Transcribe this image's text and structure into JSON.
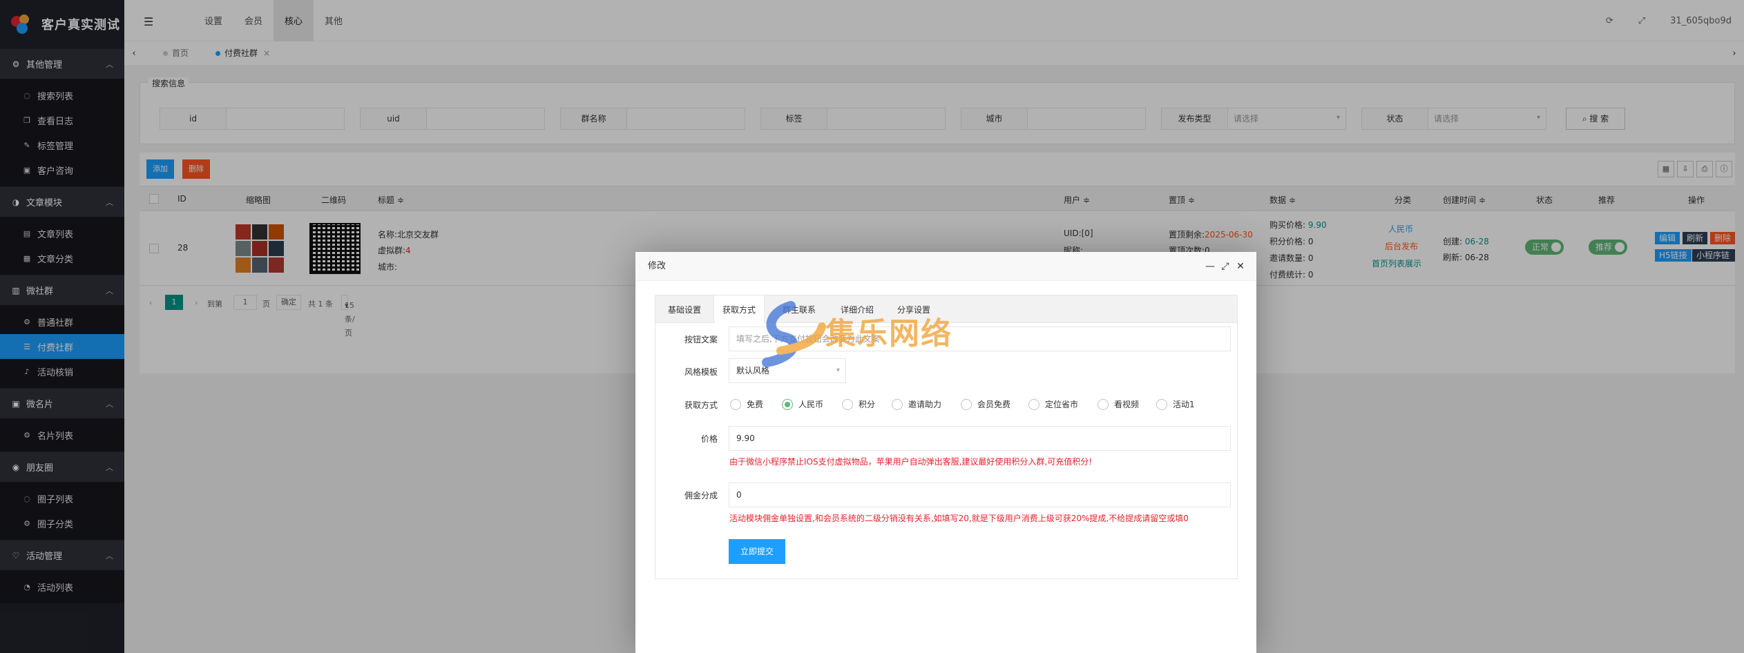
{
  "app": {
    "title": "客户真实测试"
  },
  "sidebar": {
    "groups": [
      {
        "label": "其他管理",
        "icon": "gear-icon",
        "items": [
          {
            "label": "搜索列表",
            "icon": "chat-icon"
          },
          {
            "label": "查看日志",
            "icon": "copy-icon"
          },
          {
            "label": "标签管理",
            "icon": "edit-icon"
          },
          {
            "label": "客户咨询",
            "icon": "user-icon"
          }
        ]
      },
      {
        "label": "文章模块",
        "icon": "contrast-icon",
        "items": [
          {
            "label": "文章列表",
            "icon": "doc-icon"
          },
          {
            "label": "文章分类",
            "icon": "table-icon"
          }
        ]
      },
      {
        "label": "微社群",
        "icon": "group-icon",
        "items": [
          {
            "label": "普通社群",
            "icon": "gear-icon"
          },
          {
            "label": "付费社群",
            "icon": "list-icon",
            "active": true
          },
          {
            "label": "活动核销",
            "icon": "bell-icon"
          }
        ]
      },
      {
        "label": "微名片",
        "icon": "card-icon",
        "items": [
          {
            "label": "名片列表",
            "icon": "gear-icon"
          }
        ]
      },
      {
        "label": "朋友圈",
        "icon": "circle-icon",
        "items": [
          {
            "label": "圈子列表",
            "icon": "chat-icon"
          },
          {
            "label": "圈子分类",
            "icon": "gear-icon"
          }
        ]
      },
      {
        "label": "活动管理",
        "icon": "heart-icon",
        "items": [
          {
            "label": "活动列表",
            "icon": "dashboard-icon"
          }
        ]
      }
    ]
  },
  "header": {
    "menu": [
      "设置",
      "会员",
      "核心",
      "其他"
    ],
    "active_menu": "核心",
    "user": "31_605qbo9d"
  },
  "page_tabs": [
    {
      "label": "首页"
    },
    {
      "label": "付费社群",
      "active": true
    }
  ],
  "search": {
    "legend": "搜索信息",
    "fields": [
      "id",
      "uid",
      "群名称",
      "标签",
      "城市"
    ],
    "selects": [
      {
        "label": "发布类型",
        "value": "请选择"
      },
      {
        "label": "状态",
        "value": "请选择"
      }
    ],
    "button": "搜 索"
  },
  "table": {
    "add_label": "添加",
    "delete_label": "删除",
    "columns": [
      "ID",
      "缩略图",
      "二维码",
      "标题 ≑",
      "用户 ≑",
      "置顶 ≑",
      "数据 ≑",
      "分类",
      "创建时间 ≑",
      "状态",
      "推荐",
      "操作"
    ],
    "row": {
      "id": "28",
      "title_name_label": "名称:",
      "title_name": "北京交友群",
      "title_virtual_label": "虚拟群:",
      "title_virtual": "4",
      "title_city_label": "城市:",
      "user_uid": "UID:[0]",
      "user_nick_label": "昵称:",
      "top_remain_label": "置顶剩余:",
      "top_remain": "2025-06-30",
      "top_count": "置顶次数:0",
      "data_price_label": "购买价格:",
      "data_price": "9.90",
      "data_points": "积分价格: 0",
      "data_invite": "邀请数量: 0",
      "data_paid": "付费统计: 0",
      "cat_currency": "人民币",
      "cat_backend": "后台发布",
      "cat_home": "首页列表展示",
      "created_label": "创建:",
      "created": "06-28",
      "refreshed_label": "刷新:",
      "refreshed": "06-28",
      "status": "正常",
      "recommend": "推荐",
      "ops": [
        "编辑",
        "刷新",
        "删除",
        "H5链接",
        "小程序链接"
      ]
    },
    "pager": {
      "page": "1",
      "goto_label": "到第",
      "goto_value": "1",
      "page_unit": "页",
      "confirm": "确定",
      "total": "共 1 条",
      "per_page": "15 条/页"
    }
  },
  "modal": {
    "title": "修改",
    "tabs": [
      "基础设置",
      "获取方式",
      "群主联系",
      "详细介绍",
      "分享设置"
    ],
    "active_tab": "获取方式",
    "button_text_label": "按钮文案",
    "button_text_placeholder": "填写之后,下方支付按钮会改变为此文案",
    "style_label": "风格模板",
    "style_value": "默认风格",
    "acquire_label": "获取方式",
    "acquire_options": [
      "免费",
      "人民币",
      "积分",
      "邀请助力",
      "会员免费",
      "定位省市",
      "看视频",
      "活动1"
    ],
    "acquire_selected": "人民币",
    "price_label": "价格",
    "price_value": "9.90",
    "price_tip": "由于微信小程序禁止IOS支付虚拟物品，苹果用户自动弹出客服,建议最好使用积分入群,可充值积分!",
    "commission_label": "佣金分成",
    "commission_value": "0",
    "commission_tip": "活动模块佣金单独设置,和会员系统的二级分销没有关系,如填写20,就是下级用户消费上级可获20%提成,不给提成请留空或填0",
    "submit": "立即提交"
  },
  "watermark": {
    "text": "集乐网络"
  },
  "colors": {
    "primary": "#1e9fff",
    "green": "#009688",
    "danger": "#ff5722",
    "sidebar": "#20222a"
  }
}
